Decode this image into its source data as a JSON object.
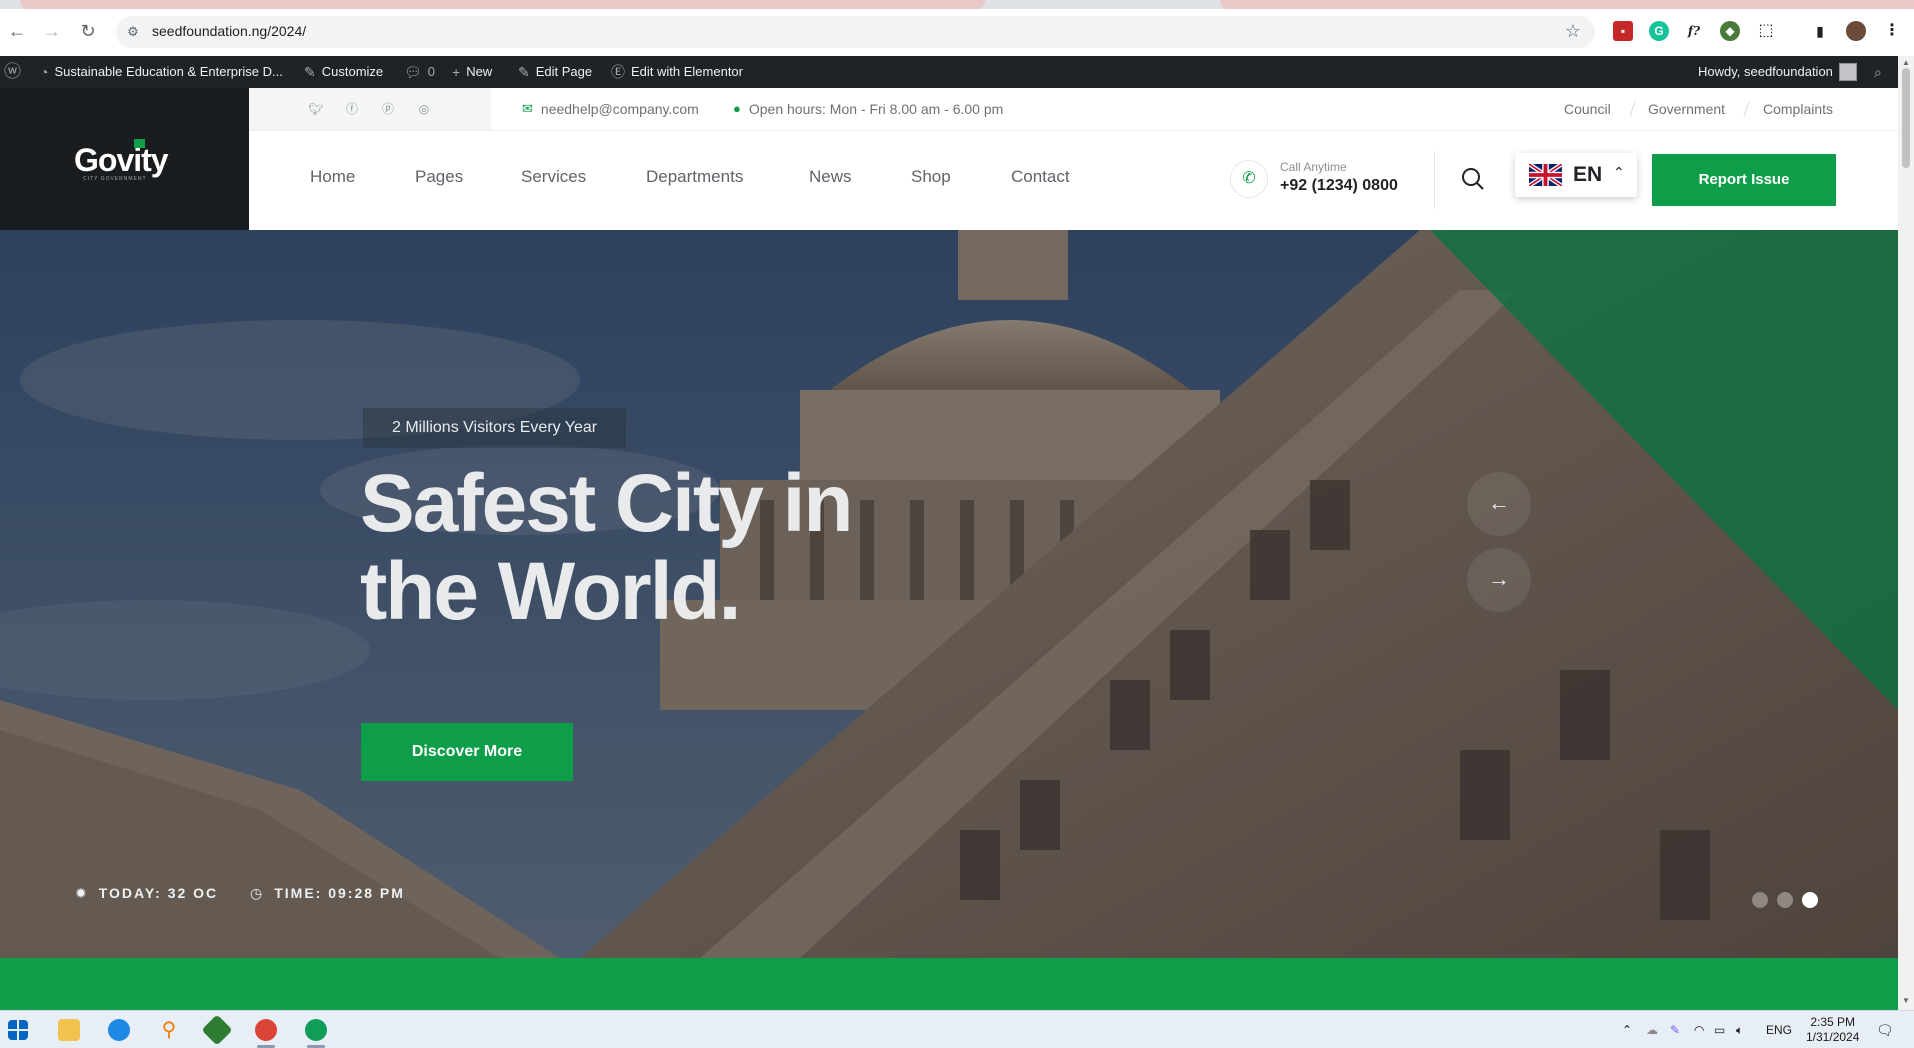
{
  "browser": {
    "url": "seedfoundation.ng/2024/",
    "icons": [
      "back-icon",
      "forward-icon",
      "reload-icon",
      "site-info-icon",
      "bookmark-star-icon",
      "extensions-icon",
      "sidebar-icon",
      "profile-icon",
      "menu-icon"
    ]
  },
  "adminbar": {
    "site_name": "Sustainable Education & Enterprise D...",
    "customize": "Customize",
    "comments_count": "0",
    "new": "New",
    "edit_page": "Edit Page",
    "edit_elementor": "Edit with Elementor",
    "howdy": "Howdy, seedfoundation"
  },
  "site": {
    "logo": {
      "name": "Govity",
      "tagline": "CITY GOVERNMENT"
    },
    "topbar": {
      "email": "needhelp@company.com",
      "hours": "Open hours: Mon - Fri 8.00 am - 6.00 pm",
      "links": [
        "Council",
        "Government",
        "Complaints"
      ]
    },
    "nav": {
      "items": [
        "Home",
        "Pages",
        "Services",
        "Departments",
        "News",
        "Shop",
        "Contact"
      ],
      "call_label": "Call Anytime",
      "call_number": "+92 (1234) 0800",
      "language": "EN",
      "report_button": "Report Issue"
    },
    "hero": {
      "kicker": "2 Millions Visitors Every Year",
      "headline_line1": "Safest City in",
      "headline_line2": "the World.",
      "cta": "Discover More",
      "weather": "TODAY: 32 OC",
      "time": "TIME: 09:28 PM",
      "slides_total": 3,
      "active_slide": 3,
      "arrow_prev": "←",
      "arrow_next": "→"
    },
    "colors": {
      "accent": "#0e9e4a",
      "dark": "#1a1d1f"
    }
  },
  "taskbar": {
    "lang": "ENG",
    "time": "2:35 PM",
    "date": "1/31/2024"
  }
}
